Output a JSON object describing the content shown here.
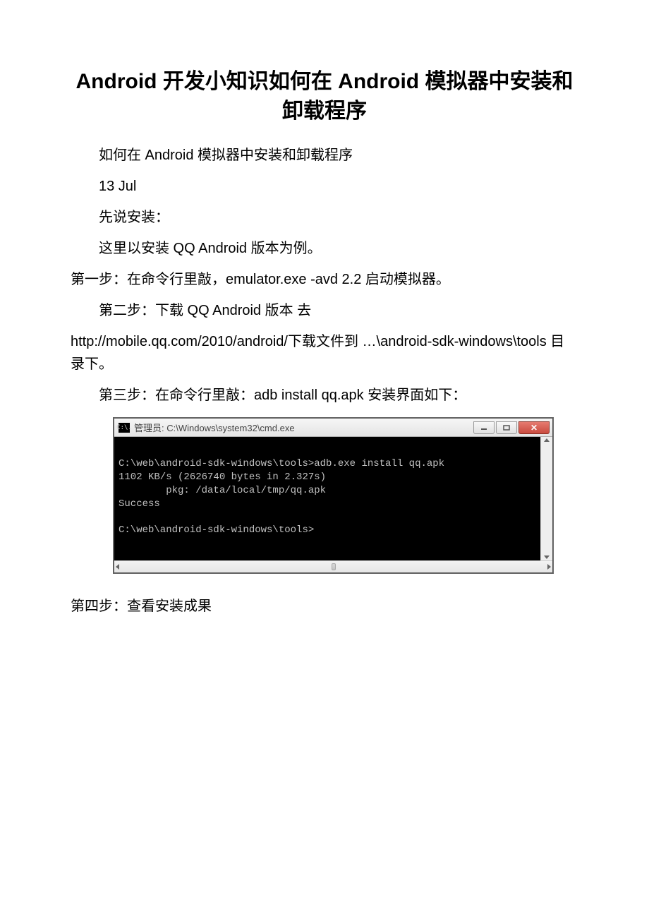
{
  "title": "Android 开发小知识如何在 Android 模拟器中安装和卸载程序",
  "para1": "如何在 Android 模拟器中安装和卸载程序",
  "para2": "13 Jul",
  "para3": "先说安装：",
  "para4": "这里以安装 QQ Android 版本为例。",
  "para5": "第一步：在命令行里敲，emulator.exe -avd 2.2 启动模拟器。",
  "para6": "第二步：下载 QQ Android 版本 去",
  "para7": "http://mobile.qq.com/2010/android/下载文件到 …\\android-sdk-windows\\tools 目录下。",
  "para8": "第三步：在命令行里敲：adb install qq.apk 安装界面如下：",
  "cmd": {
    "titlebar_icon_text": "C:\\.",
    "title": "管理员: C:\\Windows\\system32\\cmd.exe",
    "content": "\nC:\\web\\android-sdk-windows\\tools>adb.exe install qq.apk\n1102 KB/s (2626740 bytes in 2.327s)\n        pkg: /data/local/tmp/qq.apk\nSuccess\n\nC:\\web\\android-sdk-windows\\tools>"
  },
  "para9": "第四步：查看安装成果"
}
